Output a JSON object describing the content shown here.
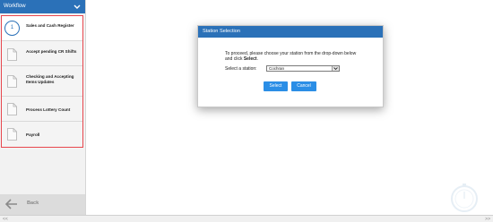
{
  "sidebar": {
    "header": {
      "label": "Workflow"
    },
    "items": [
      {
        "step": "1",
        "label": "Sales and Cash Register"
      },
      {
        "label": "Accept pending CR Shifts"
      },
      {
        "label": "Checking and Accepting Items Updates"
      },
      {
        "label": "Process Lottery Count"
      },
      {
        "label": "Payroll"
      }
    ],
    "back": {
      "label": "Back"
    }
  },
  "dialog": {
    "title": "Station Selection",
    "instruction_prefix": "To proceed, please choose your station from the drop-down below and click ",
    "instruction_bold": "Select",
    "instruction_suffix": ".",
    "select_label": "Select a station:",
    "select_value": "Cochran",
    "select_button": "Select",
    "cancel_button": "Cancel"
  },
  "scrollbar": {
    "left": "<<",
    "right": ">>"
  },
  "colors": {
    "accent": "#2b71b8",
    "button": "#2b8ee6",
    "highlight_border": "#e8474e"
  }
}
